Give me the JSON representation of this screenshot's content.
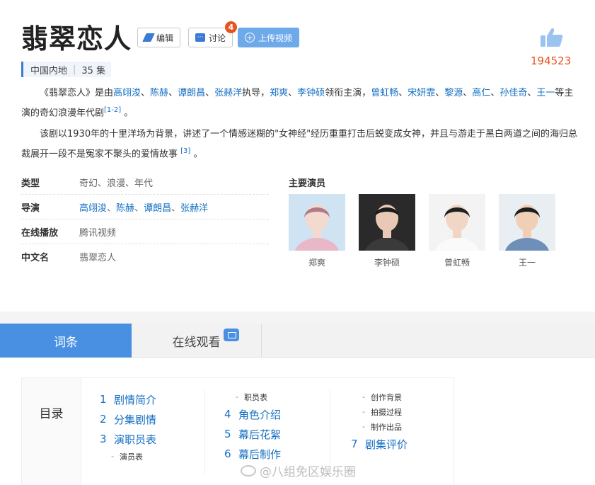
{
  "entry": {
    "title": "翡翠恋人",
    "edit_label": "编辑",
    "discuss_label": "讨论",
    "discuss_badge": "4",
    "upload_label": "上传视频",
    "like_count": "194523",
    "region": "中国内地",
    "episodes": "35 集"
  },
  "summary": {
    "p1": {
      "t1": "《翡翠恋人》是由",
      "directors": [
        "高翊浚",
        "陈赫",
        "谭朗昌",
        "张赫洋"
      ],
      "sep": "、",
      "t2": "执导，",
      "leads": [
        "郑爽",
        "李钟硕"
      ],
      "t3": "领衔主演，",
      "cast": [
        "曾虹畅",
        "宋妍霏",
        "黎源",
        "高仁",
        "孙佳奇",
        "王一"
      ],
      "t4": "等主演的奇幻浪漫年代剧",
      "ref": "[1-2]",
      "end": "。"
    },
    "p2": {
      "text": "该剧以1930年的十里洋场为背景，讲述了一个情感迷糊的\"女神经\"经历重重打击后蜕变成女神，并且与游走于黑白两道之间的海归总裁展开一段不是冤家不聚头的爱情故事",
      "ref": "[3]",
      "end": "。"
    }
  },
  "info": [
    {
      "key": "类型",
      "value": "奇幻、浪漫、年代"
    },
    {
      "key": "导演",
      "value": "高翊浚、陈赫、谭朗昌、张赫洋"
    },
    {
      "key": "在线播放",
      "value": "腾讯视频"
    },
    {
      "key": "中文名",
      "value": "翡翠恋人"
    }
  ],
  "cast": {
    "title": "主要演员",
    "members": [
      {
        "name": "郑爽",
        "bg": "#cfe3f2",
        "skin": "#f4d9cf",
        "hair": "#b07a86",
        "cloth": "#e8b8c8"
      },
      {
        "name": "李钟硕",
        "bg": "#2a2a2a",
        "skin": "#e9c9b5",
        "hair": "#1c1c1c",
        "cloth": "#3a3a3a"
      },
      {
        "name": "曾虹畅",
        "bg": "#f3f3f3",
        "skin": "#f1d6c6",
        "hair": "#222222",
        "cloth": "#fafafa"
      },
      {
        "name": "王一",
        "bg": "#e9eef2",
        "skin": "#f0cfb6",
        "hair": "#1e1e1e",
        "cloth": "#6d8fb8"
      }
    ]
  },
  "tabs": {
    "entry_label": "词条",
    "watch_label": "在线观看"
  },
  "toc": {
    "label": "目录",
    "col1": [
      {
        "type": "main",
        "num": "1",
        "text": "剧情简介"
      },
      {
        "type": "main",
        "num": "2",
        "text": "分集剧情"
      },
      {
        "type": "main",
        "num": "3",
        "text": "演职员表"
      },
      {
        "type": "sub",
        "text": "演员表"
      }
    ],
    "col2": [
      {
        "type": "sub",
        "text": "职员表"
      },
      {
        "type": "main",
        "num": "4",
        "text": "角色介绍"
      },
      {
        "type": "main",
        "num": "5",
        "text": "幕后花絮"
      },
      {
        "type": "main",
        "num": "6",
        "text": "幕后制作"
      }
    ],
    "col3": [
      {
        "type": "sub",
        "text": "创作背景"
      },
      {
        "type": "sub",
        "text": "拍摄过程"
      },
      {
        "type": "sub",
        "text": "制作出品"
      },
      {
        "type": "main",
        "num": "7",
        "text": "剧集评价"
      }
    ]
  },
  "watermark": "@八组免区娱乐圈",
  "colors": {
    "link": "#136ec2",
    "accent": "#4a90e2",
    "like": "#e8541e",
    "badge": "#e8541e"
  }
}
